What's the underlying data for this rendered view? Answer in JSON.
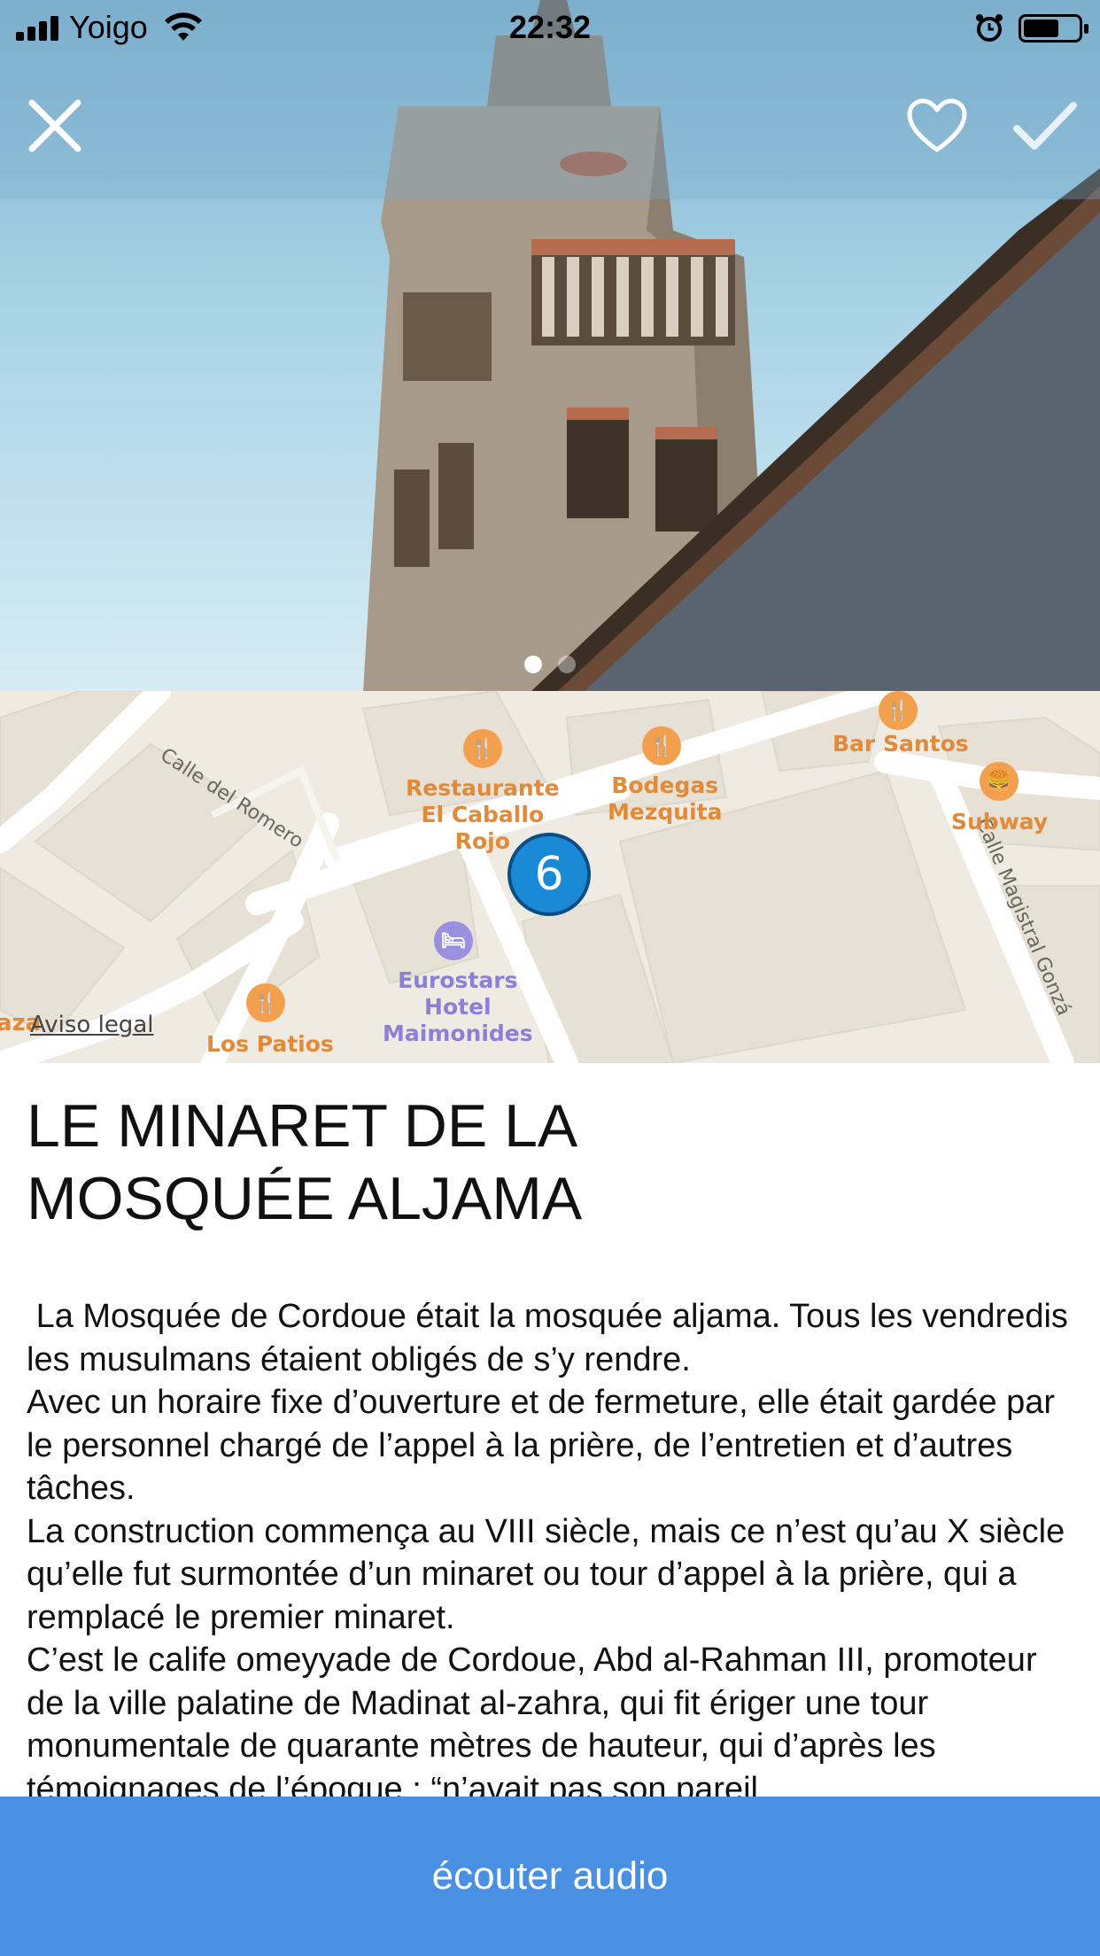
{
  "status_bar": {
    "carrier": "Yoigo",
    "time": "22:32",
    "battery_level": 0.65
  },
  "header": {
    "close_icon": "close-icon",
    "favorite_icon": "heart-outline-icon",
    "visited_icon": "checkmark-icon"
  },
  "gallery": {
    "page_count": 2,
    "active_index": 0
  },
  "map": {
    "streets": [
      "Calle del Romero",
      "Calle Magistral Gonzá"
    ],
    "pois": [
      {
        "name": "Restaurante\nEl Caballo\nRojo",
        "type": "restaurant"
      },
      {
        "name": "Bodegas\nMezquita",
        "type": "restaurant"
      },
      {
        "name": "Bar Santos",
        "type": "restaurant"
      },
      {
        "name": "Subway",
        "type": "fast-food"
      },
      {
        "name": "Eurostars\nHotel\nMaimonides",
        "type": "hotel"
      },
      {
        "name": "Los Patios",
        "type": "restaurant"
      }
    ],
    "edge_label": "aza",
    "marker_number": "6",
    "legal": "Aviso legal"
  },
  "place": {
    "title_line1": "LE MINARET DE LA",
    "title_line2": "MOSQUÉE ALJAMA",
    "description": " La Mosquée de Cordoue était la mosquée aljama. Tous les vendredis les musulmans étaient obligés de s’y rendre.\nAvec un horaire fixe d’ouverture et de fermeture, elle était gardée par le personnel chargé de l’appel à la prière, de l’entretien et d’autres tâches.\nLa construction commença au VIII siècle, mais ce n’est qu’au X siècle qu’elle fut surmontée d’un minaret ou tour d’appel à la prière, qui a remplacé le premier minaret.\nC’est le calife omeyyade de Cordoue, Abd al-Rahman III, promoteur de la ville palatine de Madinat al-zahra, qui fit ériger une tour monumentale de quarante mètres de hauteur, qui d’après les témoignages de l’époque : “n’avait pas son pareil"
  },
  "audio_button": {
    "label": "écouter audio",
    "color": "#4a90e2"
  }
}
